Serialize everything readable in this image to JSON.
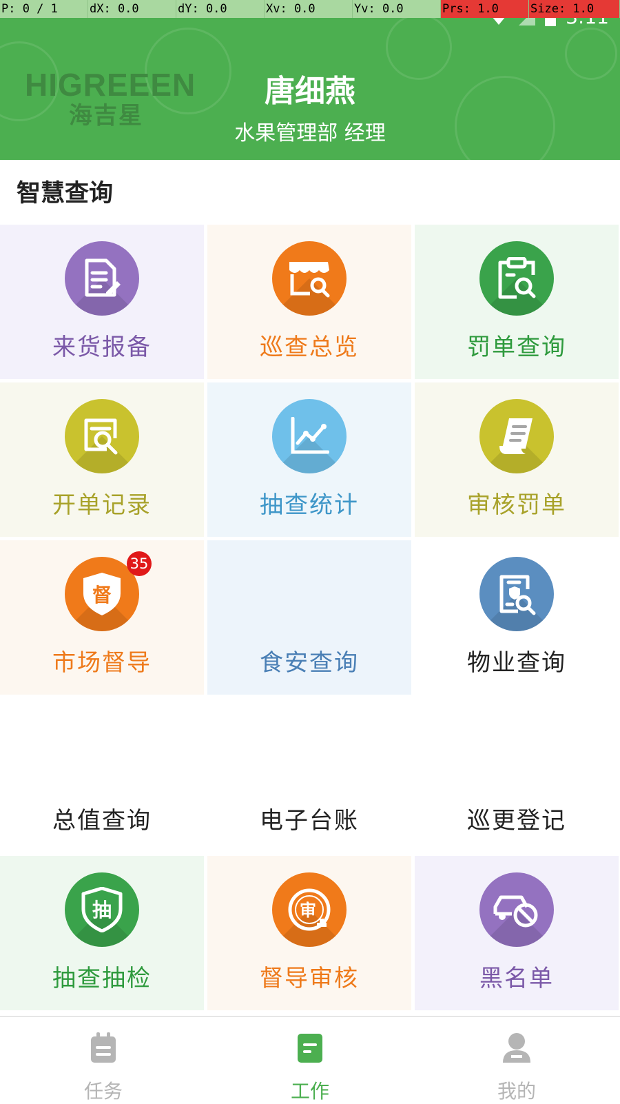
{
  "debug": {
    "pointer": "P: 0 / 1",
    "dx": "dX: 0.0",
    "dy": "dY: 0.0",
    "xv": "Xv: 0.0",
    "yv": "Yv: 0.0",
    "prs": "Prs: 1.0",
    "size": "Size: 1.0"
  },
  "status_bar": {
    "time": "3:11"
  },
  "header": {
    "logo_en": "HIGREEEN",
    "logo_cn": "海吉星",
    "user_name": "唐细燕",
    "user_dept": "水果管理部 经理"
  },
  "section": {
    "title": "智慧查询"
  },
  "tiles": [
    {
      "label": "来货报备",
      "icon": "document-edit-icon",
      "color": "#9472c0",
      "label_color": "#7b59a8",
      "bg": "#f3f1fb"
    },
    {
      "label": "巡查总览",
      "icon": "store-search-icon",
      "color": "#f07a1a",
      "label_color": "#ee7a1b",
      "bg": "#fdf7f0"
    },
    {
      "label": "罚单查询",
      "icon": "clipboard-search-icon",
      "color": "#3aa34b",
      "label_color": "#2e9a3d",
      "bg": "#eef8ef"
    },
    {
      "label": "开单记录",
      "icon": "record-search-icon",
      "color": "#c9c22e",
      "label_color": "#a8a22a",
      "bg": "#f8f8ee"
    },
    {
      "label": "抽查统计",
      "icon": "line-chart-icon",
      "color": "#6fc0ea",
      "label_color": "#3e96c8",
      "bg": "#eef6fb"
    },
    {
      "label": "审核罚单",
      "icon": "ticket-list-icon",
      "color": "#c9c22e",
      "label_color": "#a8a22a",
      "bg": "#f8f8ee"
    },
    {
      "label": "市场督导",
      "icon": "supervise-shield-icon",
      "color": "#f07a1a",
      "label_color": "#ee7a1b",
      "bg": "#fdf7f0",
      "badge": "35",
      "glyph": "督"
    },
    {
      "label": "食安查询",
      "icon": "",
      "color": "",
      "label_color": "#4a7fb5",
      "bg": "#edf4fb"
    },
    {
      "label": "物业查询",
      "icon": "property-search-icon",
      "color": "#5b8ec0",
      "label_color": "#222222",
      "bg": "#ffffff"
    },
    {
      "label": "总值查询",
      "icon": "",
      "color": "",
      "label_color": "#222222",
      "bg": "#ffffff"
    },
    {
      "label": "电子台账",
      "icon": "",
      "color": "",
      "label_color": "#222222",
      "bg": "#ffffff"
    },
    {
      "label": "巡更登记",
      "icon": "",
      "color": "",
      "label_color": "#222222",
      "bg": "#ffffff"
    },
    {
      "label": "抽查抽检",
      "icon": "spot-check-shield-icon",
      "color": "#3aa34b",
      "label_color": "#2e9a3d",
      "bg": "#eef8ef",
      "glyph": "抽"
    },
    {
      "label": "督导审核",
      "icon": "review-stamp-icon",
      "color": "#f07a1a",
      "label_color": "#ee7a1b",
      "bg": "#fdf7f0",
      "glyph": "审"
    },
    {
      "label": "黑名单",
      "icon": "car-blocked-icon",
      "color": "#9472c0",
      "label_color": "#7b59a8",
      "bg": "#f3f1fb"
    }
  ],
  "nav": [
    {
      "label": "任务",
      "icon": "clipboard-icon",
      "color": "#b5b5b5"
    },
    {
      "label": "工作",
      "icon": "document-icon",
      "color": "#4caf50"
    },
    {
      "label": "我的",
      "icon": "person-icon",
      "color": "#b5b5b5"
    }
  ]
}
